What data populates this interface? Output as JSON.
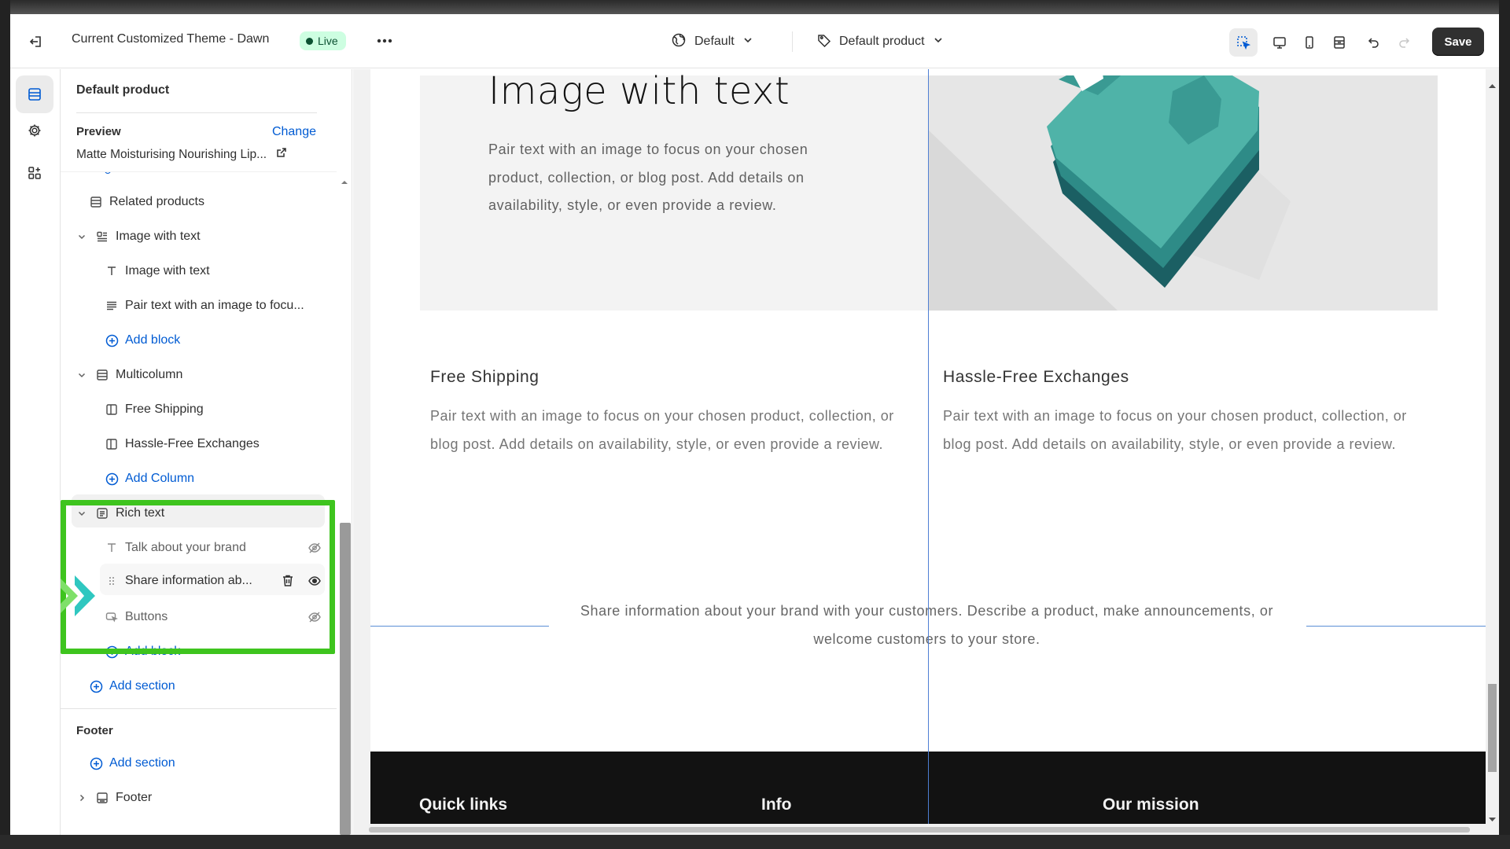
{
  "topbar": {
    "title": "Current Customized Theme - Dawn",
    "live_badge": "Live",
    "theme_selector": "Default",
    "template_selector": "Default product",
    "save_label": "Save"
  },
  "sidebar": {
    "heading": "Default product",
    "preview_label": "Preview",
    "change_label": "Change",
    "preview_value": "Matte Moisturising Nourishing Lip...",
    "items": [
      {
        "label": "Related products"
      },
      {
        "label": "Image with text"
      },
      {
        "label": "Image with text"
      },
      {
        "label": "Pair text with an image to focu..."
      },
      {
        "label": "Add block"
      },
      {
        "label": "Multicolumn"
      },
      {
        "label": "Free Shipping"
      },
      {
        "label": "Hassle-Free Exchanges"
      },
      {
        "label": "Add Column"
      },
      {
        "label": "Rich text"
      },
      {
        "label": "Talk about your brand"
      },
      {
        "label": "Share information ab..."
      },
      {
        "label": "Buttons"
      },
      {
        "label": "Add block"
      },
      {
        "label": "Add section"
      }
    ],
    "footer_group_label": "Footer",
    "footer_add_section": "Add section",
    "footer_item": "Footer"
  },
  "preview": {
    "image_with_text": {
      "title": "Image with text",
      "body": "Pair text with an image to focus on your chosen product, collection, or blog post. Add details on availability, style, or even provide a review."
    },
    "multicolumn": [
      {
        "title": "Free Shipping",
        "body": "Pair text with an image to focus on your chosen product, collection, or blog post. Add details on availability, style, or even provide a review."
      },
      {
        "title": "Hassle-Free Exchanges",
        "body": "Pair text with an image to focus on your chosen product, collection, or blog post. Add details on availability, style, or even provide a review."
      }
    ],
    "rich_text": "Share information about your brand with your customers. Describe a product, make announcements, or welcome customers to your store.",
    "footer_columns": [
      "Quick links",
      "Info",
      "Our mission"
    ]
  },
  "colors": {
    "highlight": "#3ec41e",
    "link_blue": "#005bd3",
    "live_bg": "#cdfee1",
    "save_bg": "#303030"
  }
}
